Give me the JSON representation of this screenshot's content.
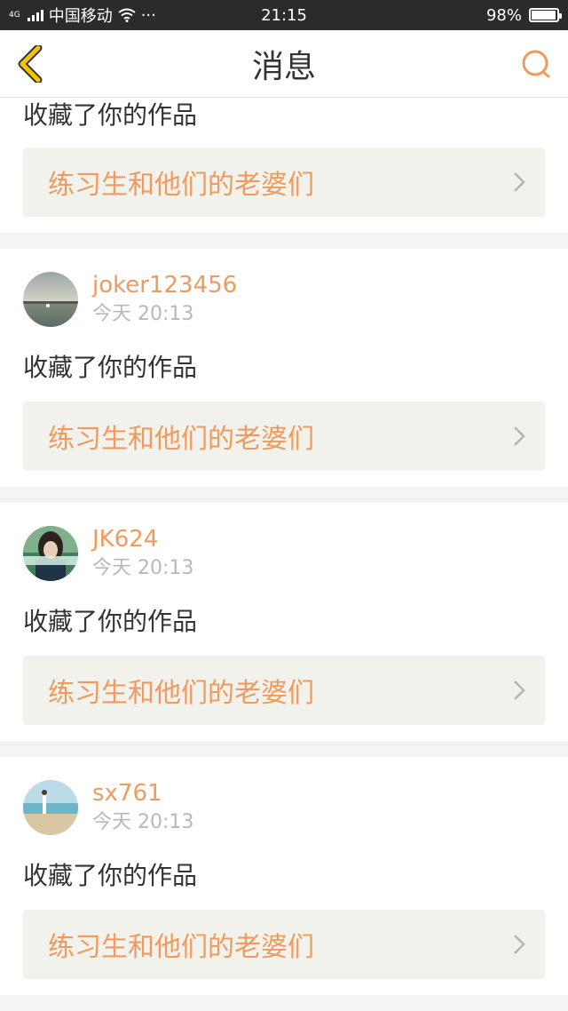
{
  "status_bar": {
    "network": "4G",
    "carrier": "中国移动",
    "more": "···",
    "time": "21:15",
    "battery_percent": "98%",
    "battery_level": 0.98
  },
  "nav": {
    "title": "消息",
    "back_icon": "chevron-left-icon",
    "search_icon": "search-icon"
  },
  "colors": {
    "accent": "#ef9a5e",
    "back_arrow": "#f5c400",
    "link_bg": "#f2f2ec"
  },
  "messages": [
    {
      "action": "收藏了你的作品",
      "work_title": "练习生和他们的老婆们"
    },
    {
      "username": "joker123456",
      "time": "今天 20:13",
      "action": "收藏了你的作品",
      "work_title": "练习生和他们的老婆们",
      "avatar": "lake-sky-avatar"
    },
    {
      "username": "JK624",
      "time": "今天 20:13",
      "action": "收藏了你的作品",
      "work_title": "练习生和他们的老婆们",
      "avatar": "girl-portrait-avatar"
    },
    {
      "username": "sx761",
      "time": "今天 20:13",
      "action": "收藏了你的作品",
      "work_title": "练习生和他们的老婆们",
      "avatar": "beach-avatar"
    }
  ]
}
